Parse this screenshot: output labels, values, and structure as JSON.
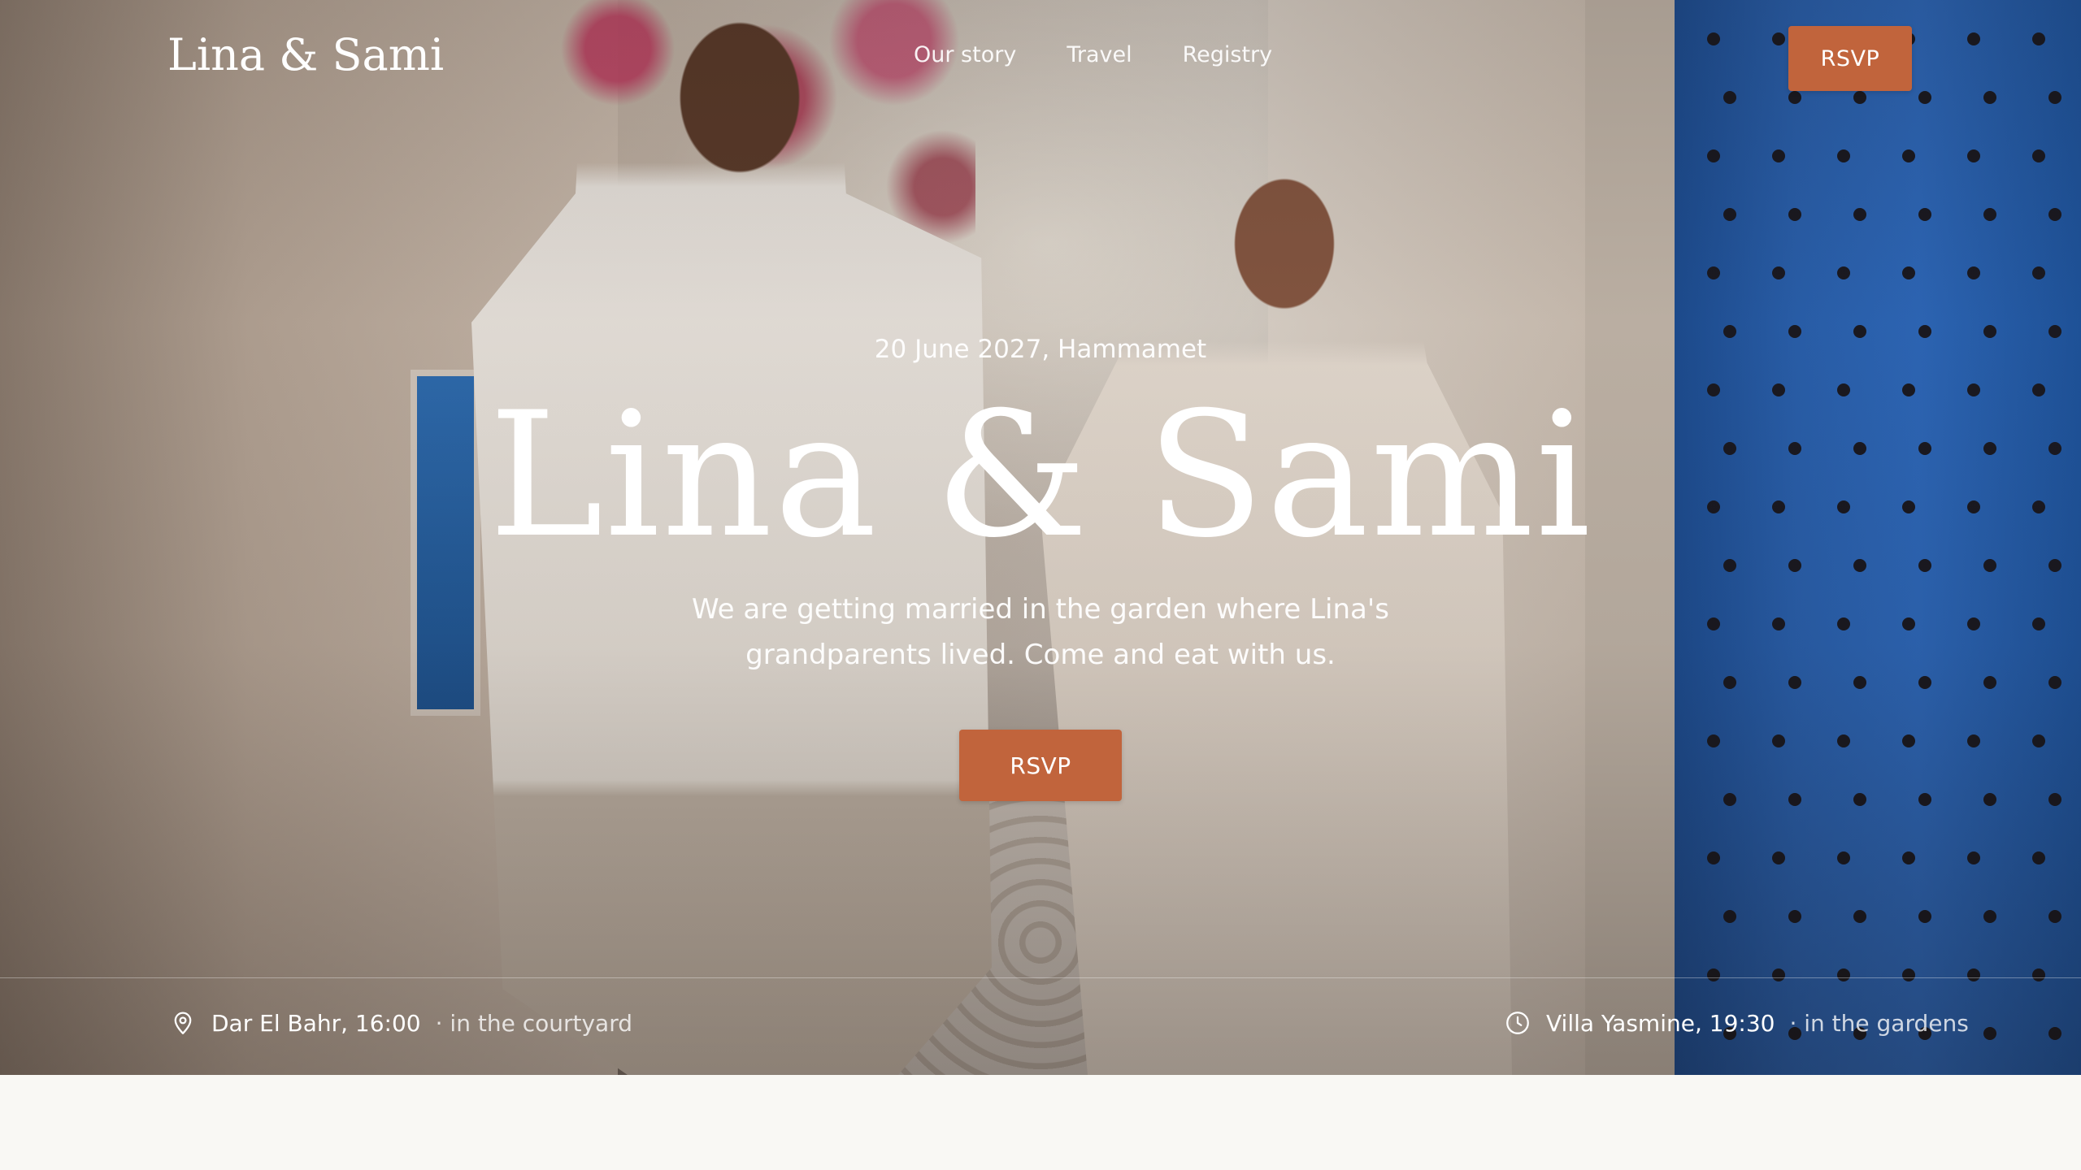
{
  "header": {
    "logo": "Lina & Sami",
    "nav": [
      "Our story",
      "Travel",
      "Registry"
    ],
    "rsvp_label": "RSVP"
  },
  "hero": {
    "date_place": "20 June 2027, Hammamet",
    "title": "Lina & Sami",
    "subtitle": "We are getting married in the garden where Lina's grandparents lived. Come and eat with us.",
    "rsvp_label": "RSVP"
  },
  "details": {
    "ceremony": {
      "icon": "map-pin-icon",
      "venue_time": "Dar El Bahr, 16:00",
      "note": "· in the courtyard"
    },
    "reception": {
      "icon": "clock-icon",
      "venue_time": "Villa Yasmine, 19:30",
      "note": "· in the gardens"
    }
  },
  "colors": {
    "accent": "#c1643c",
    "page_background": "#f9f8f4",
    "door_blue": "#2a63b3"
  }
}
